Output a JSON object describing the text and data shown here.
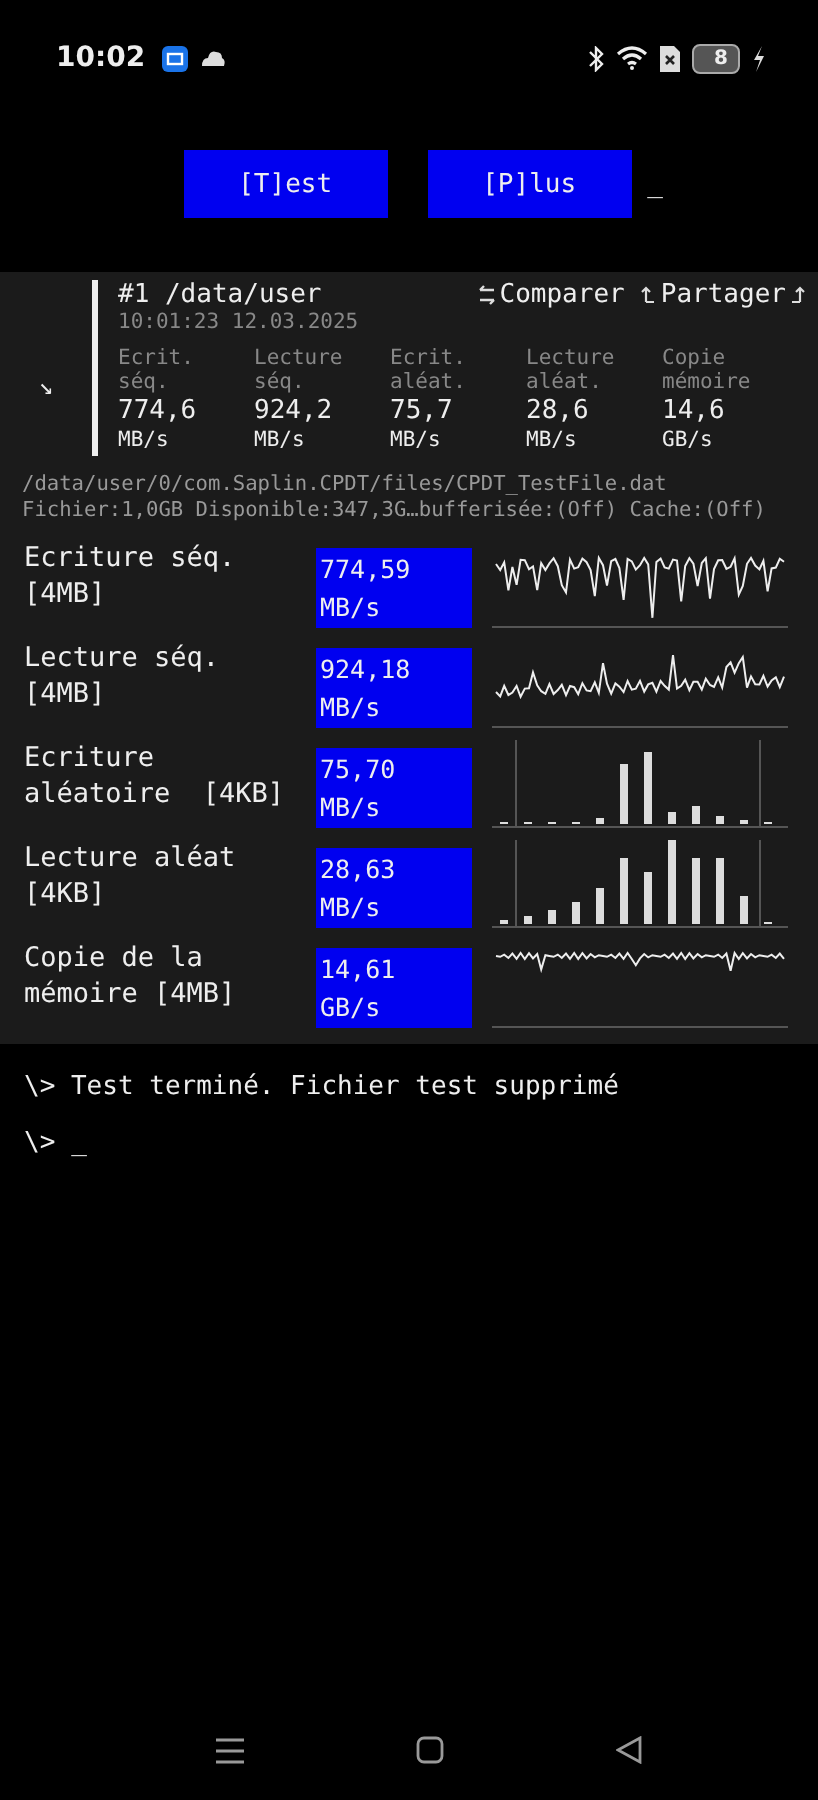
{
  "status_bar": {
    "time": "10:02",
    "battery": "8"
  },
  "toolbar": {
    "buttons": [
      "[T]est",
      "[P]lus"
    ],
    "cursor": "_"
  },
  "summary": {
    "expand_glyph": "↘",
    "title": "#1 /data/user",
    "timestamp": "10:01:23 12.03.2025",
    "actions": [
      "Comparer",
      "Partager"
    ],
    "metrics": [
      {
        "label": "Ecrit. séq.",
        "value": "774,6",
        "unit": "MB/s"
      },
      {
        "label": "Lecture séq.",
        "value": "924,2",
        "unit": "MB/s"
      },
      {
        "label": "Ecrit. aléat.",
        "value": "75,7",
        "unit": "MB/s"
      },
      {
        "label": "Lecture aléat.",
        "value": "28,6",
        "unit": "MB/s"
      },
      {
        "label": "Copie mémoire",
        "value": "14,6",
        "unit": "GB/s"
      }
    ]
  },
  "file_info": [
    "/data/user/0/com.Saplin.CPDT/files/CPDT_TestFile.dat",
    "Fichier:1,0GB Disponible:347,3G…bufferisée:(Off) Cache:(Off)"
  ],
  "results": [
    {
      "label": "Ecriture séq. [4MB]",
      "value": "774,59",
      "unit": "MB/s",
      "kind": "line"
    },
    {
      "label": "Lecture séq. [4MB]",
      "value": "924,18",
      "unit": "MB/s",
      "kind": "line"
    },
    {
      "label": "Ecriture aléatoire  [4KB]",
      "value": "75,70",
      "unit": "MB/s",
      "kind": "bars"
    },
    {
      "label": "Lecture aléat [4KB]",
      "value": "28,63",
      "unit": "MB/s",
      "kind": "bars"
    },
    {
      "label": "Copie de la mémoire [4MB]",
      "value": "14,61",
      "unit": "GB/s",
      "kind": "line"
    }
  ],
  "console": {
    "lines": [
      "\\> Test terminé. Fichier test supprimé"
    ],
    "prompt": "\\>",
    "cursor": "_"
  }
}
